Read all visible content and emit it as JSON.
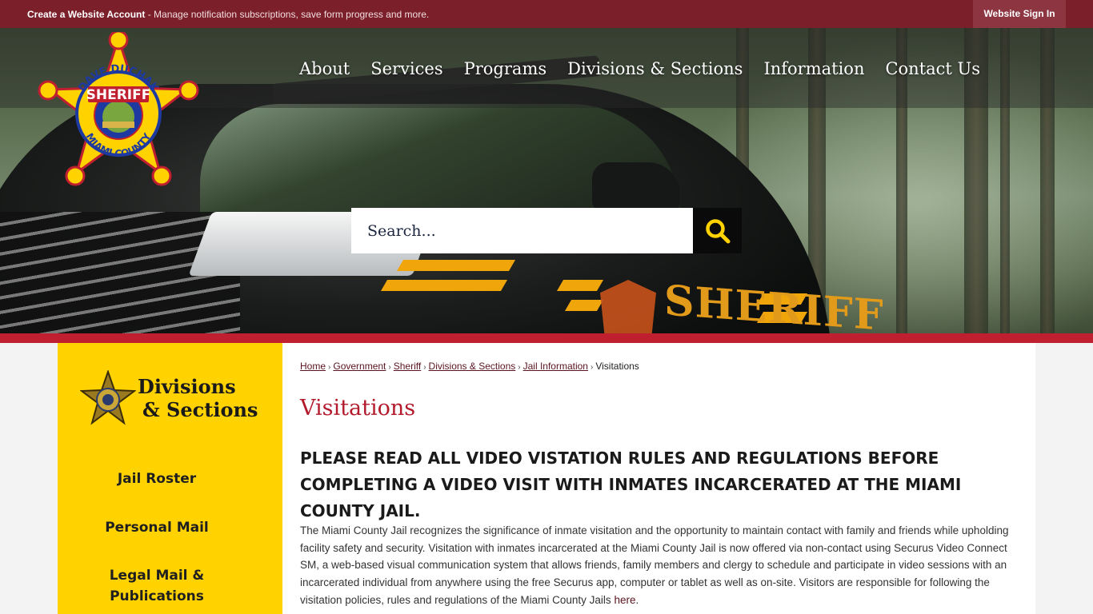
{
  "topbar": {
    "create_account_label": "Create a Website Account",
    "create_account_desc": " - Manage notification subscriptions, save form progress and more.",
    "sign_in_label": "Website Sign In"
  },
  "logo": {
    "top_text": "DAVE DUCHAK",
    "middle_text": "SHERIFF",
    "bottom_text": "MIAMI COUNTY",
    "icon": "sheriff-star-badge"
  },
  "nav": {
    "items": [
      "About",
      "Services",
      "Programs",
      "Divisions & Sections",
      "Information",
      "Contact Us"
    ]
  },
  "hero": {
    "car_door_text": "SHERIFF"
  },
  "search": {
    "placeholder": "Search...",
    "icon": "search-icon"
  },
  "sidebar": {
    "title_line1": "Divisions",
    "title_line2": "& Sections",
    "items": [
      {
        "label": "Jail Roster"
      },
      {
        "label": "Personal Mail"
      },
      {
        "label": "Legal Mail & Publications"
      }
    ]
  },
  "breadcrumb": {
    "items": [
      "Home",
      "Government",
      "Sheriff",
      "Divisions & Sections",
      "Jail Information"
    ],
    "current": "Visitations"
  },
  "page": {
    "title": "Visitations",
    "notice": "PLEASE READ ALL VIDEO VISTATION RULES AND REGULATIONS BEFORE COMPLETING A VIDEO VISIT WITH INMATES INCARCERATED AT THE MIAMI COUNTY JAIL.",
    "body": "The Miami County Jail recognizes the significance of inmate visitation and the opportunity to maintain contact with family and friends while upholding facility safety and security. Visitation with inmates incarcerated at the Miami County Jail is now offered via non-contact using Securus Video Connect SM, a web-based visual communication system that allows friends, family members and clergy to schedule and participate in video sessions with an incarcerated individual from anywhere using the free Securus app, computer or tablet as well as on-site. Visitors are responsible for following the visitation policies, rules and regulations of the Miami County Jails ",
    "body_link": "here",
    "body_end": "."
  },
  "colors": {
    "topbar": "#7b1f2b",
    "accent_red": "#c01f2f",
    "sidebar_yellow": "#ffd200",
    "title_red": "#b31b2c"
  }
}
